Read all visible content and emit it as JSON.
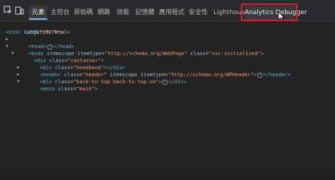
{
  "tabs": [
    {
      "label": "元素",
      "active": true
    },
    {
      "label": "主控台"
    },
    {
      "label": "原始碼"
    },
    {
      "label": "網路"
    },
    {
      "label": "效能"
    },
    {
      "label": "記憶體"
    },
    {
      "label": "應用程式"
    },
    {
      "label": "安全性"
    },
    {
      "label": "Lighthouse"
    },
    {
      "label": "Analytics Debugger",
      "highlighted": true
    }
  ],
  "toolbar": {
    "inspect_icon": "inspect-element-icon",
    "device_icon": "device-toolbar-icon"
  },
  "dom": {
    "doctype": "<!DOCTYPE html>",
    "html_open": "<html",
    "html_lang_attr": "lang",
    "html_lang_val": "\"zh-TW\"",
    "html_close": ">",
    "head_open": "<head>",
    "head_close": "</head>",
    "body_open": "<body",
    "body_attr1": "itemscope",
    "body_attr2": "itemtype",
    "body_itemtype_val": "\"http://schema.org/WebPage\"",
    "body_class_attr": "class",
    "body_class_val": "\"vsc-initialized\"",
    "container_open": "<div",
    "container_class_attr": "class",
    "container_class_val": "\"container\"",
    "headband_open": "<div",
    "headband_class_attr": "class",
    "headband_class_val": "\"headband\"",
    "headband_close": "></div>",
    "header_open": "<header",
    "header_class_attr": "class",
    "header_class_val": "\"header\"",
    "header_itemscope": "itemscope",
    "header_itemtype_attr": "itemtype",
    "header_itemtype_val": "\"http://schema.org/WPHeader\"",
    "header_close": "</header>",
    "btt_open": "<div",
    "btt_class_attr": "class",
    "btt_class_val": "\"back-to-top back-to-top-on\"",
    "btt_close": "</div>",
    "main_open": "<main",
    "main_class_attr": "class",
    "main_class_val": "\"main\"",
    "gt": ">",
    "ellipsis": "⋯"
  },
  "colors": {
    "tag": "#5db0d7",
    "attr_name": "#9bbbdc",
    "attr_value": "#f29766",
    "highlight_box": "#e2202c",
    "active_tab_underline": "#8ab4f8"
  }
}
